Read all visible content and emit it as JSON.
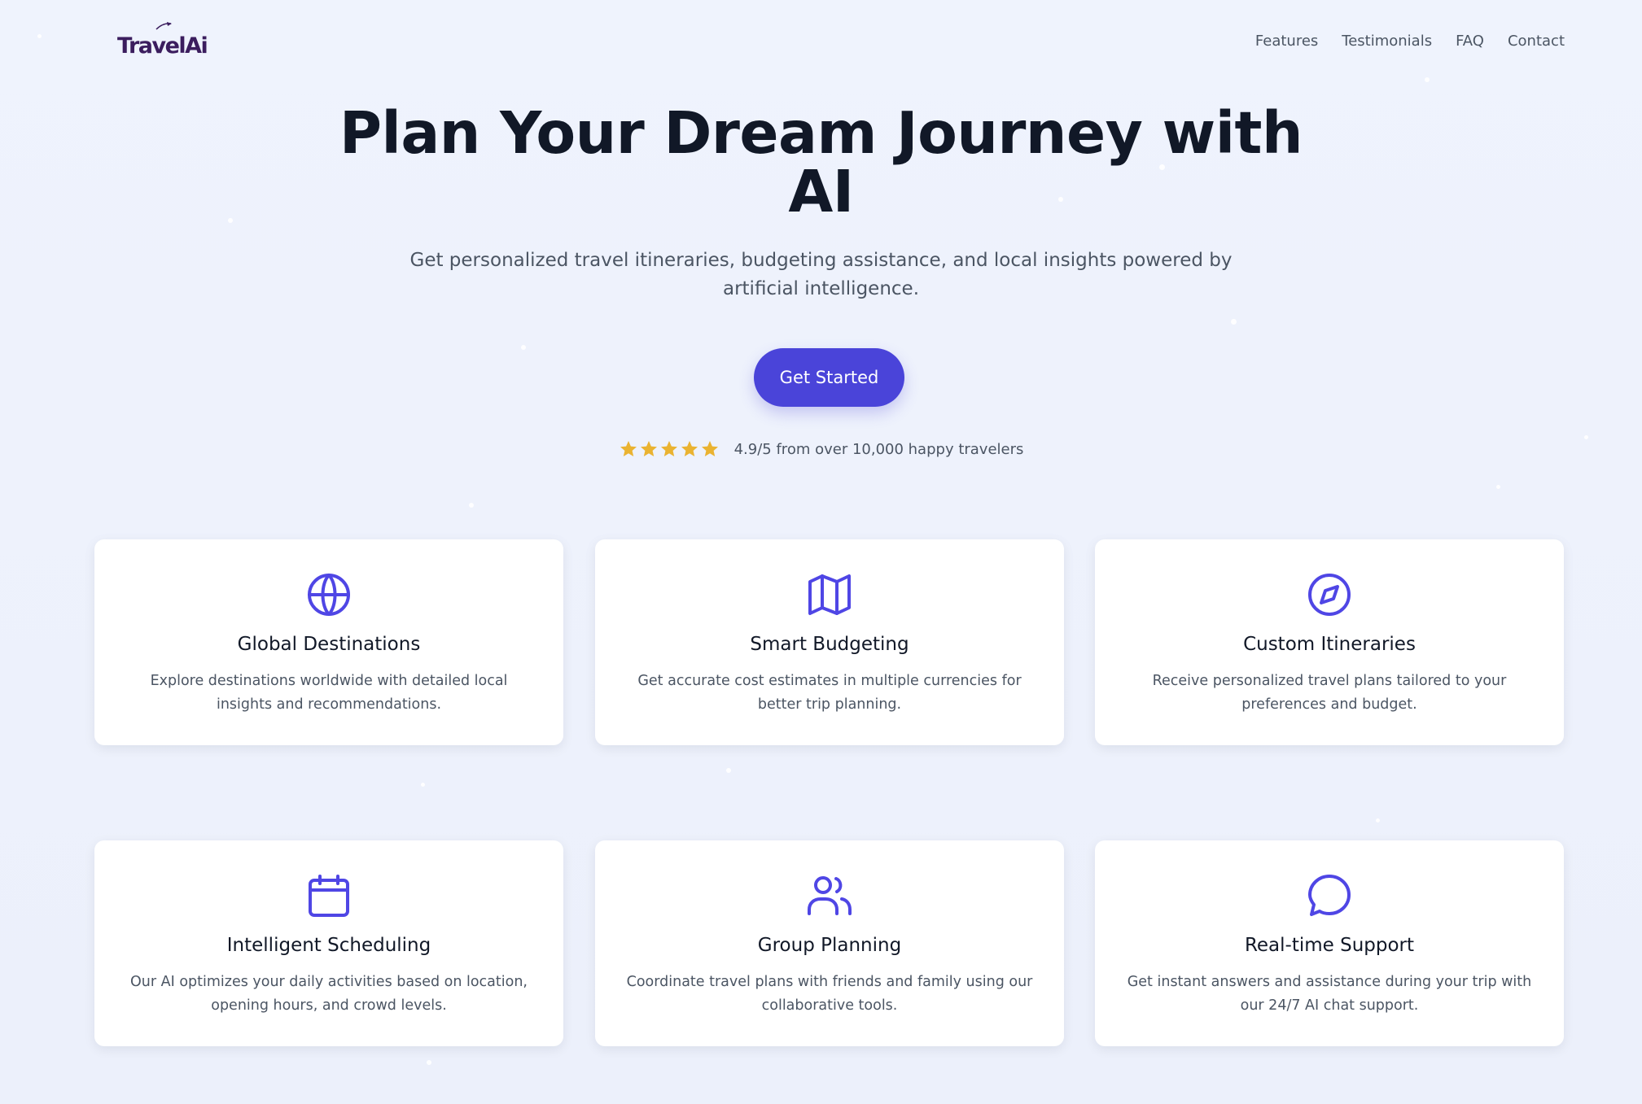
{
  "header": {
    "logo": "TravelAi",
    "nav": [
      "Features",
      "Testimonials",
      "FAQ",
      "Contact"
    ]
  },
  "hero": {
    "title_line1": "Plan Your Dream Journey with",
    "title_line2": "AI",
    "subtitle": "Get personalized travel itineraries, budgeting assistance, and local insights powered by artificial intelligence.",
    "cta": "Get Started",
    "rating_text": "4.9/5 from over 10,000 happy travelers",
    "stars": 5
  },
  "features": [
    {
      "icon": "globe-icon",
      "title": "Global Destinations",
      "desc": "Explore destinations worldwide with detailed local insights and recommendations."
    },
    {
      "icon": "map-icon",
      "title": "Smart Budgeting",
      "desc": "Get accurate cost estimates in multiple currencies for better trip planning."
    },
    {
      "icon": "compass-icon",
      "title": "Custom Itineraries",
      "desc": "Receive personalized travel plans tailored to your preferences and budget."
    },
    {
      "icon": "calendar-icon",
      "title": "Intelligent Scheduling",
      "desc": "Our AI optimizes your daily activities based on location, opening hours, and crowd levels."
    },
    {
      "icon": "users-icon",
      "title": "Group Planning",
      "desc": "Coordinate travel plans with friends and family using our collaborative tools."
    },
    {
      "icon": "chat-icon",
      "title": "Real-time Support",
      "desc": "Get instant answers and assistance during your trip with our 24/7 AI chat support."
    }
  ],
  "colors": {
    "accent": "#4a44d9",
    "icon": "#4f46e5",
    "star": "#eab331",
    "logo": "#3b1d5e"
  }
}
